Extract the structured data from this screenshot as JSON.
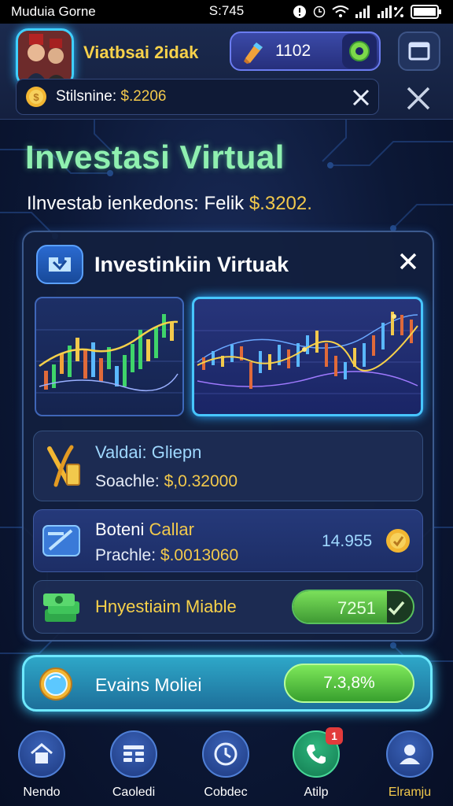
{
  "status_bar": {
    "app_name": "Muduia Gorne",
    "time": "S:745"
  },
  "header": {
    "player_name": "Viatbsai 2idak",
    "gems": "1102",
    "balance_label": "Stilsnine:",
    "balance_value": "$.2206"
  },
  "hero": {
    "title": "Investasi Virtual",
    "subtitle_text": "Ilnvestab ienkedons: Felik",
    "subtitle_amount": "$.3202."
  },
  "panel": {
    "title": "Investinkiin Virtuak",
    "rows": [
      {
        "title": "Valdai: Gliepn",
        "sub_label": "Soachle:",
        "sub_value": "$,0.32000"
      },
      {
        "title_white": "Boteni",
        "title_gold": "Callar",
        "sub_label": "Prachle:",
        "sub_value": "$.0013060",
        "value": "14.955"
      },
      {
        "title": "Hnyestiaim Miable",
        "progress_value": "7251",
        "progress_fraction": 0.78
      }
    ]
  },
  "action": {
    "label": "Evains Moliei",
    "button": "7.3,8%"
  },
  "nav": [
    {
      "label": "Nendo",
      "icon": "home-icon"
    },
    {
      "label": "Caoledi",
      "icon": "grid-icon"
    },
    {
      "label": "Cobdec",
      "icon": "clock-icon"
    },
    {
      "label": "Atilp",
      "icon": "phone-icon",
      "badge": "1"
    },
    {
      "label": "Elramju",
      "icon": "profile-icon"
    }
  ],
  "colors": {
    "accent_gold": "#f2c94c",
    "title_green": "#8ff0b0",
    "glow_cyan": "#3fd0ff",
    "button_green": "#59c15d"
  }
}
